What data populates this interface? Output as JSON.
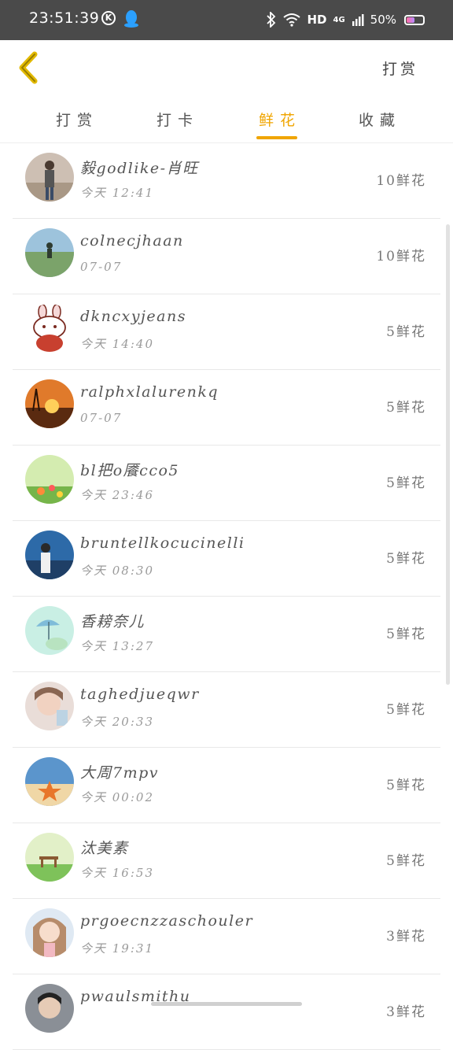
{
  "status_bar": {
    "time": "23:51:39",
    "k_badge": "K",
    "hd": "HD",
    "network": "4G",
    "battery": "50%",
    "battery_level": 0.5
  },
  "header": {
    "action_label": "打赏"
  },
  "tabs": [
    {
      "label": "打赏",
      "active": false
    },
    {
      "label": "打卡",
      "active": false
    },
    {
      "label": "鲜花",
      "active": true
    },
    {
      "label": "收藏",
      "active": false
    }
  ],
  "list": [
    {
      "name": "毅godlike-肖旺",
      "time": "今天 12:41",
      "count": "10鲜花",
      "avatar": "person-standing"
    },
    {
      "name": "colnecjhaan",
      "time": "07-07",
      "count": "10鲜花",
      "avatar": "field-person"
    },
    {
      "name": "dkncxyjeans",
      "time": "今天 14:40",
      "count": "5鲜花",
      "avatar": "bunny-cartoon"
    },
    {
      "name": "ralphxlalurenkq",
      "time": "07-07",
      "count": "5鲜花",
      "avatar": "sunset"
    },
    {
      "name": "bl把o餍cco5",
      "time": "今天 23:46",
      "count": "5鲜花",
      "avatar": "green-flowers"
    },
    {
      "name": "bruntellkocucinelli",
      "time": "今天 08:30",
      "count": "5鲜花",
      "avatar": "person-blue"
    },
    {
      "name": "香耪奈儿",
      "time": "今天 13:27",
      "count": "5鲜花",
      "avatar": "umbrella-art"
    },
    {
      "name": "taghedjueqwr",
      "time": "今天 20:33",
      "count": "5鲜花",
      "avatar": "girl-portrait"
    },
    {
      "name": "大周7mpv",
      "time": "今天 00:02",
      "count": "5鲜花",
      "avatar": "beach-starfish"
    },
    {
      "name": "汰美素",
      "time": "今天 16:53",
      "count": "5鲜花",
      "avatar": "green-bench"
    },
    {
      "name": "prgoecnzzaschouler",
      "time": "今天 19:31",
      "count": "3鲜花",
      "avatar": "girl-cute"
    },
    {
      "name": "pwaulsmithu",
      "time": "",
      "count": "3鲜花",
      "avatar": "boy-portrait"
    }
  ],
  "colors": {
    "accent": "#f0a500",
    "status_bar_bg": "#4a4a4a",
    "divider": "#e8e8e8"
  }
}
